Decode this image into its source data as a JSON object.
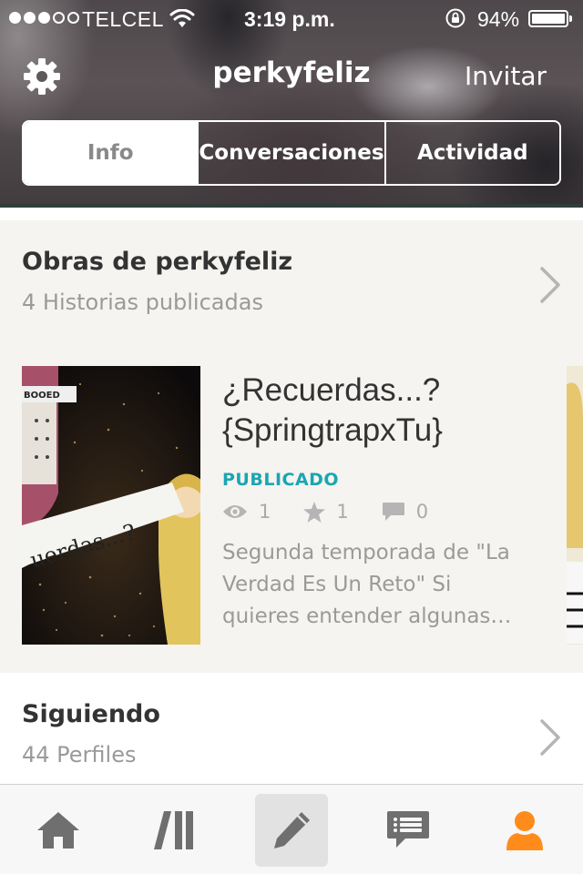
{
  "status_bar": {
    "carrier": "TELCEL",
    "time": "3:19 p.m.",
    "battery": "94%",
    "signal_strength": 3
  },
  "nav": {
    "title": "perkyfeliz",
    "invite_label": "Invitar"
  },
  "segments": [
    {
      "label": "Info",
      "active": true
    },
    {
      "label": "Conversaciones",
      "active": false
    },
    {
      "label": "Actividad",
      "active": false
    }
  ],
  "works_section": {
    "title": "Obras de perkyfeliz",
    "subtitle": "4 Historias publicadas",
    "story": {
      "title_line1": "¿Recuerdas...?",
      "title_line2": "{SpringtrapxTu}",
      "status": "PUBLICADO",
      "reads": "1",
      "votes": "1",
      "comments": "0",
      "description": "Segunda temporada de \"La Verdad Es Un Reto\"  Si quieres entender algunas…",
      "cover_text": "uerdas...?",
      "cover_badge": "BOOED"
    }
  },
  "following_section": {
    "title": "Siguiendo",
    "subtitle": "44 Perfiles"
  },
  "tabbar": {
    "items": [
      "home-icon",
      "library-icon",
      "write-icon",
      "notifications-icon",
      "profile-icon"
    ],
    "active": "profile-icon",
    "active_color": "#ff8c1a",
    "inactive_color": "#6f6f6f"
  },
  "colors": {
    "accent_teal": "#1aa6b1",
    "accent_orange": "#ff8c1a"
  }
}
